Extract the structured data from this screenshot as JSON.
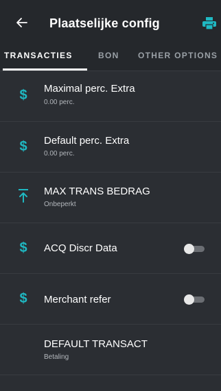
{
  "appbar": {
    "title": "Plaatselijke config",
    "back_icon": "arrow-left-icon",
    "print_icon": "printer-icon",
    "print_color": "#1fb8c2"
  },
  "tabs": [
    {
      "label": "TRANSACTIES",
      "active": true
    },
    {
      "label": "BON",
      "active": false
    },
    {
      "label": "OTHER OPTIONS",
      "active": false
    }
  ],
  "rows": [
    {
      "icon": "dollar-icon",
      "label": "Maximal perc. Extra",
      "sub": "0.00 perc."
    },
    {
      "icon": "dollar-icon",
      "label": "Default perc. Extra",
      "sub": "0.00 perc."
    },
    {
      "icon": "upload-limit-icon",
      "label": "MAX TRANS BEDRAG",
      "sub": "Onbeperkt"
    },
    {
      "icon": "dollar-icon",
      "label": "ACQ Discr Data",
      "toggle": false
    },
    {
      "icon": "dollar-icon",
      "label": "Merchant refer",
      "toggle": false
    },
    {
      "icon": "",
      "label": "DEFAULT TRANSACT",
      "sub": "Betaling"
    }
  ],
  "colors": {
    "accent": "#1fb8c2",
    "background": "#2b2e33",
    "appbar": "#25282c"
  }
}
